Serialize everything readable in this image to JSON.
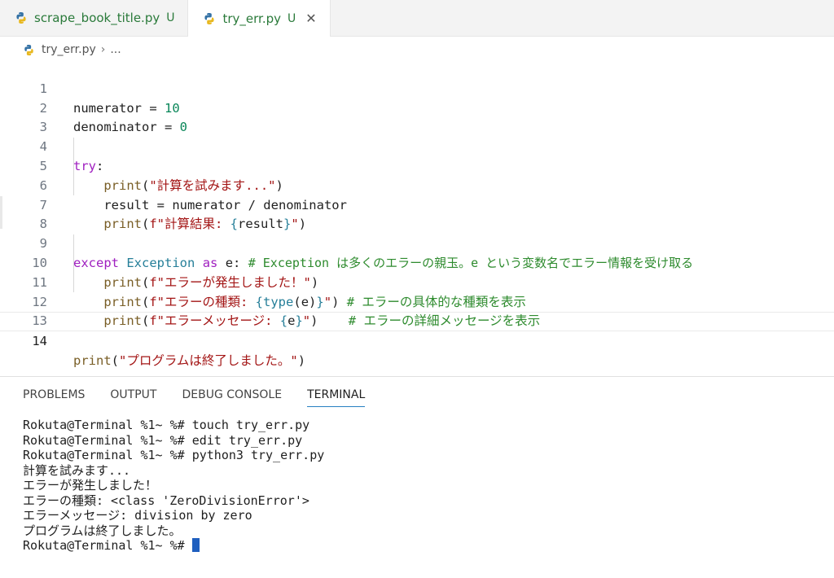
{
  "tabs": [
    {
      "name": "scrape_book_title.py",
      "status": "U",
      "active": false
    },
    {
      "name": "try_err.py",
      "status": "U",
      "active": true,
      "close": "✕"
    }
  ],
  "breadcrumb": {
    "file": "try_err.py",
    "sep": "›",
    "rest": "..."
  },
  "editor": {
    "line_numbers": [
      "1",
      "2",
      "3",
      "4",
      "5",
      "6",
      "7",
      "8",
      "9",
      "10",
      "11",
      "12",
      "13",
      "14"
    ],
    "lines": {
      "l1": {
        "a": "numerator = ",
        "b": "10"
      },
      "l2": {
        "a": "denominator = ",
        "b": "0"
      },
      "l4": {
        "a": "try",
        "b": ":"
      },
      "l5": {
        "fn": "print",
        "p1": "(",
        "s": "\"計算を試みます...\"",
        "p2": ")"
      },
      "l6": {
        "a": "result = numerator / denominator"
      },
      "l7": {
        "fn": "print",
        "p1": "(",
        "s1": "f\"計算結果: ",
        "e1": "{",
        "v": "result",
        "e2": "}",
        "s2": "\"",
        "p2": ")"
      },
      "l9": {
        "kw1": "except",
        "cls": "Exception",
        "kw2": "as",
        "v": "e:",
        "cmt": "# Exception は多くのエラーの親玉。e という変数名でエラー情報を受け取る"
      },
      "l10": {
        "fn": "print",
        "p1": "(",
        "s": "f\"エラーが発生しました！\"",
        "p2": ")"
      },
      "l11": {
        "fn": "print",
        "p1": "(",
        "s1": "f\"エラーの種類: ",
        "e1": "{",
        "f2": "type",
        "p3": "(",
        "v": "e",
        "p4": ")",
        "e2": "}",
        "s2": "\"",
        "p2": ")",
        "cmt": "# エラーの具体的な種類を表示"
      },
      "l12": {
        "fn": "print",
        "p1": "(",
        "s1": "f\"エラーメッセージ: ",
        "e1": "{",
        "v": "e",
        "e2": "}",
        "s2": "\"",
        "p2": ")",
        "cmt": "# エラーの詳細メッセージを表示"
      },
      "l14": {
        "fn": "print",
        "p1": "(",
        "s": "\"プログラムは終了しました。\"",
        "p2": ")"
      }
    }
  },
  "panel": {
    "tabs": [
      "PROBLEMS",
      "OUTPUT",
      "DEBUG CONSOLE",
      "TERMINAL"
    ],
    "active_tab": "TERMINAL"
  },
  "terminal": {
    "lines": [
      "Rokuta@Terminal %1~ %# touch try_err.py",
      "Rokuta@Terminal %1~ %# edit try_err.py",
      "Rokuta@Terminal %1~ %# python3 try_err.py",
      "計算を試みます...",
      "エラーが発生しました！",
      "エラーの種類: <class 'ZeroDivisionError'>",
      "エラーメッセージ: division by zero",
      "プログラムは終了しました。"
    ],
    "prompt": "Rokuta@Terminal %1~ %# "
  },
  "colors": {
    "accent": "#2680c2",
    "git_untracked": "#2a7a3a",
    "cursor": "#1f5fbf"
  }
}
